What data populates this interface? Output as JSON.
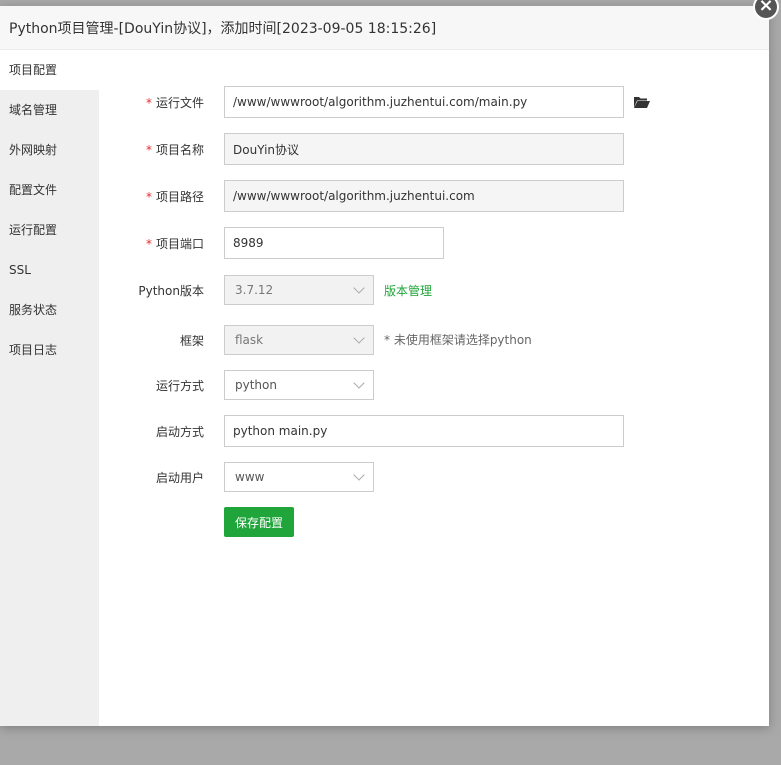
{
  "dialog": {
    "title": "Python项目管理-[DouYin协议]，添加时间[2023-09-05 18:15:26]",
    "close_icon": "close-icon"
  },
  "sidebar": {
    "items": [
      {
        "label": "项目配置",
        "active": true
      },
      {
        "label": "域名管理"
      },
      {
        "label": "外网映射"
      },
      {
        "label": "配置文件"
      },
      {
        "label": "运行配置"
      },
      {
        "label": "SSL"
      },
      {
        "label": "服务状态"
      },
      {
        "label": "项目日志"
      }
    ]
  },
  "form": {
    "required_mark": "*",
    "run_file": {
      "label": "运行文件",
      "value": "/www/wwwroot/algorithm.juzhentui.com/main.py",
      "icon": "folder-open-icon"
    },
    "project_name": {
      "label": "项目名称",
      "value": "DouYin协议"
    },
    "project_path": {
      "label": "项目路径",
      "value": "/www/wwwroot/algorithm.juzhentui.com"
    },
    "project_port": {
      "label": "项目端口",
      "value": "8989"
    },
    "python_version": {
      "label": "Python版本",
      "value": "3.7.12",
      "link": "版本管理"
    },
    "framework": {
      "label": "框架",
      "value": "flask",
      "hint": "* 未使用框架请选择python"
    },
    "run_mode": {
      "label": "运行方式",
      "value": "python"
    },
    "start_cmd": {
      "label": "启动方式",
      "value": "python main.py"
    },
    "run_user": {
      "label": "启动用户",
      "value": "www"
    },
    "save_label": "保存配置"
  },
  "colors": {
    "accent": "#20a53a",
    "required": "#e12d2d"
  }
}
